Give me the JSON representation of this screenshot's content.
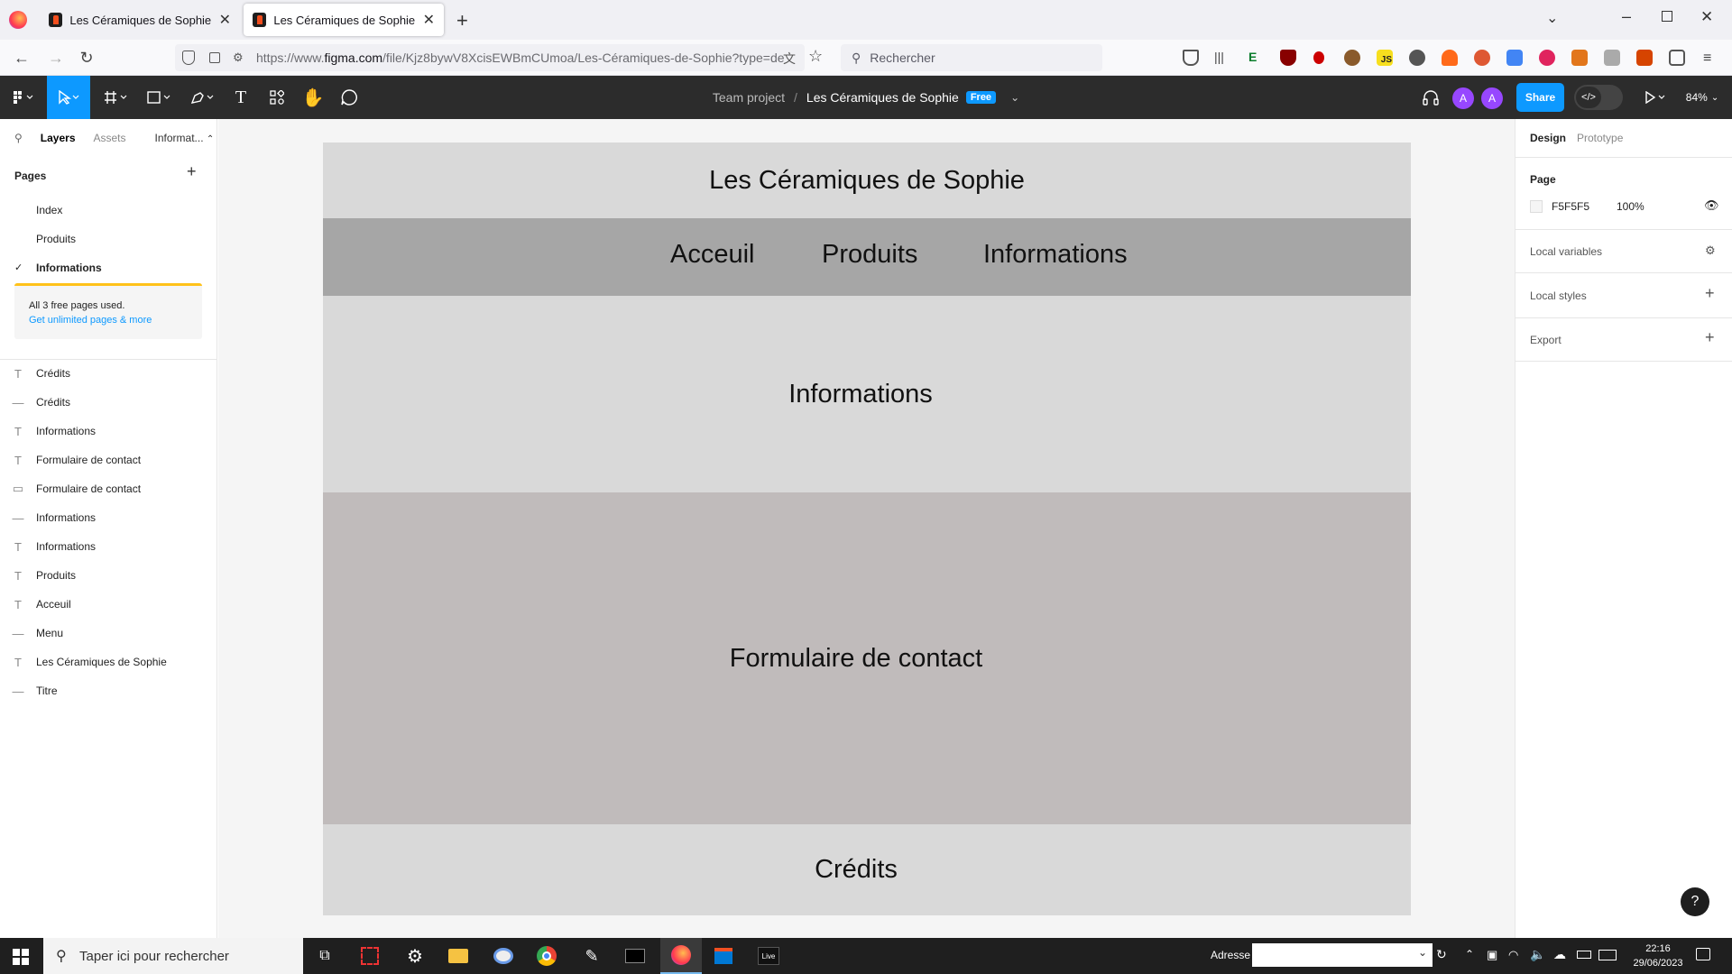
{
  "browser": {
    "tabs": [
      {
        "title": "Les Céramiques de Sophie – Figma"
      },
      {
        "title": "Les Céramiques de Sophie – Figma"
      }
    ],
    "url_prefix": "https://www.",
    "url_host": "figma.com",
    "url_path": "/file/Kjz8bywV8XcisEWBmCUmoa/Les-Céramiques-de-Sophie?type=de",
    "search_placeholder": "Rechercher"
  },
  "figma": {
    "breadcrumb_project": "Team project",
    "breadcrumb_sep": "/",
    "file_name": "Les Céramiques de Sophie",
    "plan_badge": "Free",
    "avatars": [
      "A",
      "A"
    ],
    "share_label": "Share",
    "zoom": "84%"
  },
  "left_panel": {
    "tabs": [
      "Layers",
      "Assets",
      "Informat..."
    ],
    "pages_heading": "Pages",
    "pages": [
      "Index",
      "Produits",
      "Informations"
    ],
    "current_page_check": "✓",
    "upgrade_text": "All 3 free pages used.",
    "upgrade_link": "Get unlimited pages & more",
    "layers": [
      {
        "icon": "T",
        "name": "Crédits"
      },
      {
        "icon": "—",
        "name": "Crédits"
      },
      {
        "icon": "T",
        "name": "Informations"
      },
      {
        "icon": "T",
        "name": "Formulaire de contact"
      },
      {
        "icon": "▭",
        "name": "Formulaire de contact"
      },
      {
        "icon": "—",
        "name": "Informations"
      },
      {
        "icon": "T",
        "name": "Informations"
      },
      {
        "icon": "T",
        "name": "Produits"
      },
      {
        "icon": "T",
        "name": "Acceuil"
      },
      {
        "icon": "—",
        "name": "Menu"
      },
      {
        "icon": "T",
        "name": "Les Céramiques de Sophie"
      },
      {
        "icon": "—",
        "name": "Titre"
      }
    ]
  },
  "canvas": {
    "site_title": "Les Céramiques de Sophie",
    "menu": [
      "Acceuil",
      "Produits",
      "Informations"
    ],
    "info_heading": "Informations",
    "form_heading": "Formulaire de contact",
    "credits": "Crédits"
  },
  "right_panel": {
    "tabs": [
      "Design",
      "Prototype"
    ],
    "page_heading": "Page",
    "bg_color_hex": "F5F5F5",
    "bg_opacity": "100%",
    "local_variables": "Local variables",
    "local_styles": "Local styles",
    "export": "Export",
    "help": "?"
  },
  "taskbar": {
    "search_placeholder": "Taper ici pour rechercher",
    "address_label": "Adresse",
    "time": "22:16",
    "date": "29/06/2023",
    "live_label": "Live"
  },
  "colors": {
    "figma_blue": "#0d99ff",
    "toolbar_bg": "#2c2c2c",
    "canvas_bg": "#f5f5f5",
    "menu_band": "#a6a6a6",
    "form_band": "#c0bbbb",
    "frame_bg": "#d9d9d9",
    "upgrade_accent": "#ffc21a"
  }
}
